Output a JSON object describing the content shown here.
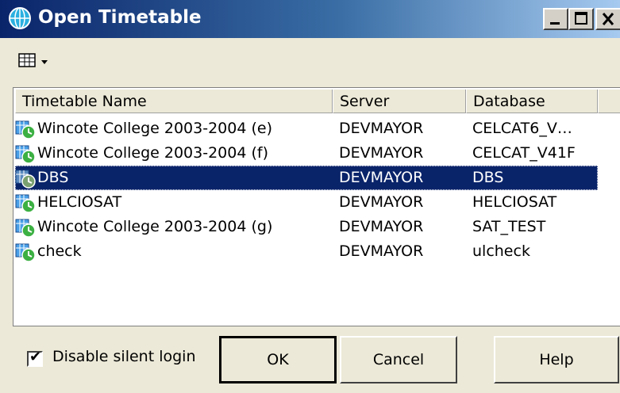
{
  "window": {
    "title": "Open Timetable",
    "icon": "globe-icon"
  },
  "titlebar_buttons": {
    "minimize": "minimize-icon",
    "maximize": "maximize-icon",
    "close": "close-icon"
  },
  "toolbar": {
    "view_button_icon": "grid-view-icon",
    "dropdown_icon": "chevron-down-icon"
  },
  "list": {
    "headers": [
      "Timetable Name",
      "Server",
      "Database"
    ],
    "rows": [
      {
        "name": "Wincote College 2003-2004 (e)",
        "server": "DEVMAYOR",
        "database": "CELCAT6_V…",
        "selected": false
      },
      {
        "name": "Wincote College 2003-2004 (f)",
        "server": "DEVMAYOR",
        "database": "CELCAT_V41F",
        "selected": false
      },
      {
        "name": "DBS",
        "server": "DEVMAYOR",
        "database": "DBS",
        "selected": true
      },
      {
        "name": "HELCIOSAT",
        "server": "DEVMAYOR",
        "database": "HELCIOSAT",
        "selected": false
      },
      {
        "name": "Wincote College 2003-2004 (g)",
        "server": "DEVMAYOR",
        "database": "SAT_TEST",
        "selected": false
      },
      {
        "name": "check",
        "server": "DEVMAYOR",
        "database": "ulcheck",
        "selected": false
      }
    ]
  },
  "footer": {
    "disable_silent_login_label": "Disable silent login",
    "disable_silent_login_checked": true,
    "ok_label": "OK",
    "cancel_label": "Cancel",
    "help_label": "Help"
  },
  "colors": {
    "selection": "#0a246a",
    "titlebar_start": "#0a246a",
    "titlebar_end": "#a6caf0",
    "dialog_bg": "#ece9d8"
  }
}
